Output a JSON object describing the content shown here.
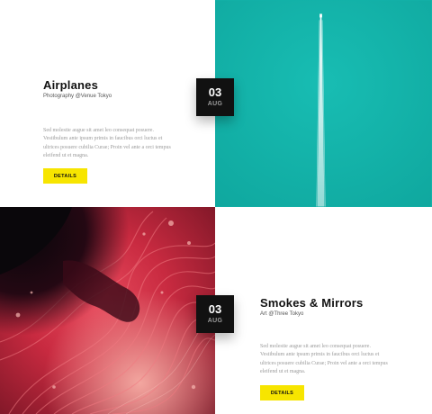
{
  "posts": [
    {
      "title": "Airplanes",
      "meta": "Photography  @Venue Tokyo",
      "body": "Sed molestie augue sit amet leo consequat posuere. Vestibulum ante ipsum primis in faucibus orci luctus et ultrices posuere cubilia Curae; Proin vel ante a orci tempus eleifend ut et magna.",
      "button": "DETAILS",
      "date_day": "03",
      "date_month": "AUG",
      "image": "airplane-contrail-photo"
    },
    {
      "title": "Smokes & Mirrors",
      "meta": "Art @Three Tokyo",
      "body": "Sed molestie augue sit amet leo consequat posuere. Vestibulum ante ipsum primis in faucibus orci luctus et ultrices posuere cubilia Curae; Proin vel ante a orci tempus eleifend ut et magna.",
      "button": "DETAILS",
      "date_day": "03",
      "date_month": "AUG",
      "image": "red-marble-ink-photo"
    }
  ],
  "colors": {
    "accent": "#f7e500",
    "teal": "#12b2a9",
    "date_box": "#111111"
  }
}
